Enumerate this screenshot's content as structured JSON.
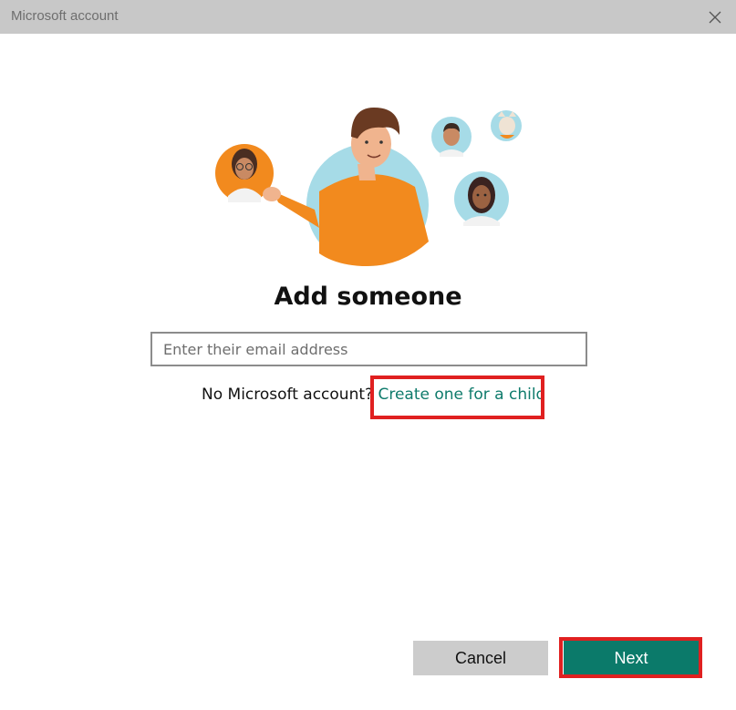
{
  "window": {
    "title": "Microsoft account"
  },
  "main": {
    "heading": "Add someone",
    "email_placeholder": "Enter their email address",
    "no_account_text": "No Microsoft account?",
    "create_child_link": "Create one for a child"
  },
  "footer": {
    "cancel_label": "Cancel",
    "next_label": "Next"
  },
  "colors": {
    "accent": "#0b7a6a",
    "link": "#0f7b6c",
    "highlight": "#e02020",
    "titlebar": "#c8c8c8",
    "illustration_orange": "#f28a1e",
    "illustration_blue": "#a6dbe7"
  }
}
